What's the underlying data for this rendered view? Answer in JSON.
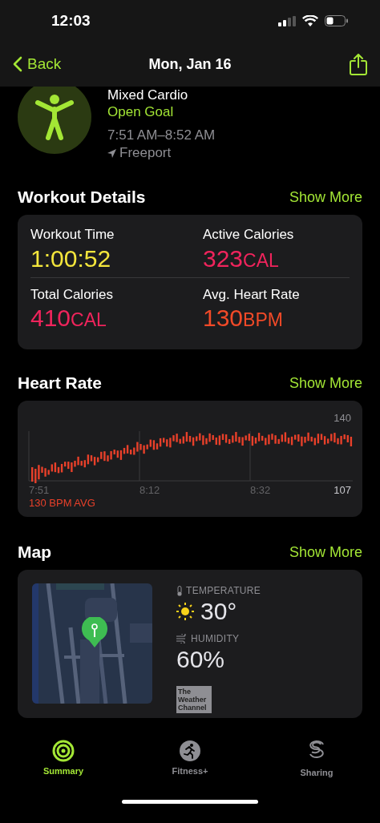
{
  "status_bar": {
    "time": "12:03"
  },
  "nav": {
    "back": "Back",
    "title": "Mon, Jan 16"
  },
  "workout": {
    "name": "Mixed Cardio",
    "goal": "Open Goal",
    "time_range": "7:51 AM–8:52 AM",
    "location": "Freeport"
  },
  "details": {
    "title": "Workout Details",
    "more": "Show More",
    "metrics": [
      {
        "label": "Workout Time",
        "value": "1:00:52",
        "color": "#f4e63c"
      },
      {
        "label": "Active Calories",
        "value": "323",
        "unit": "CAL",
        "color": "#f0245c"
      },
      {
        "label": "Total Calories",
        "value": "410",
        "unit": "CAL",
        "color": "#f0245c"
      },
      {
        "label": "Avg. Heart Rate",
        "value": "130",
        "unit": "BPM",
        "color": "#f24a28"
      }
    ]
  },
  "heart_rate": {
    "title": "Heart Rate",
    "more": "Show More",
    "max_label": "140",
    "min_label": "107",
    "time_labels": [
      "7:51",
      "8:12",
      "8:32"
    ],
    "average": "130 BPM AVG"
  },
  "map": {
    "title": "Map",
    "more": "Show More",
    "temperature_label": "TEMPERATURE",
    "temperature": "30°",
    "humidity_label": "HUMIDITY",
    "humidity": "60%",
    "source": "The Weather Channel"
  },
  "tabs": [
    {
      "label": "Summary",
      "selected": true
    },
    {
      "label": "Fitness+",
      "selected": false
    },
    {
      "label": "Sharing",
      "selected": false
    }
  ]
}
